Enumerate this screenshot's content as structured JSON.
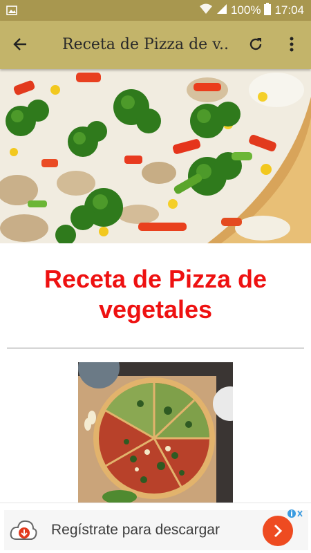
{
  "status_bar": {
    "battery": "100%",
    "time": "17:04"
  },
  "app_bar": {
    "title": "Receta de Pizza de v..."
  },
  "recipe": {
    "title": "Receta de Pizza de vegetales"
  },
  "ad": {
    "text": "Regístrate para descargar"
  },
  "colors": {
    "status_bar": "#a8974f",
    "app_bar": "#c3b46a",
    "title_red": "#ee1111",
    "ad_button": "#ee4b21"
  }
}
